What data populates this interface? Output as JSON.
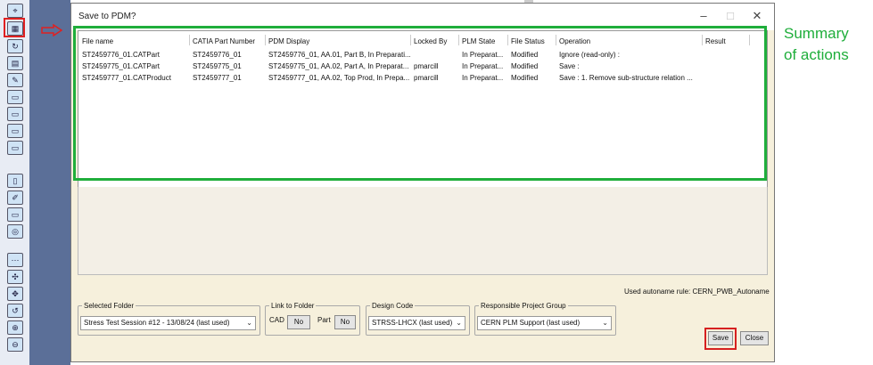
{
  "dialog": {
    "title": "Save to PDM?",
    "columns": [
      "File name",
      "CATIA Part Number",
      "PDM Display",
      "Locked By",
      "PLM State",
      "File Status",
      "Operation",
      "Result"
    ],
    "rows": [
      {
        "file": "ST2459776_01.CATPart",
        "part": "ST2459776_01",
        "display": "ST2459776_01, AA.01, Part B, In Preparati...",
        "locked": "",
        "state": "In Preparat...",
        "status": "Modified",
        "operation": "Ignore (read-only) :",
        "result": ""
      },
      {
        "file": "ST2459775_01.CATPart",
        "part": "ST2459775_01",
        "display": "ST2459775_01, AA.02, Part A, In Preparat...",
        "locked": "pmarcill",
        "state": "In Preparat...",
        "status": "Modified",
        "operation": "Save :",
        "result": ""
      },
      {
        "file": "ST2459777_01.CATProduct",
        "part": "ST2459777_01",
        "display": "ST2459777_01, AA.02, Top Prod, In Prepa...",
        "locked": "pmarcill",
        "state": "In Preparat...",
        "status": "Modified",
        "operation": "Save : 1. Remove sub-structure relation ...",
        "result": ""
      }
    ],
    "autoname": "Used autoname rule: CERN_PWB_Autoname",
    "selected_folder": {
      "label": "Selected Folder",
      "value": "Stress Test Session #12 - 13/08/24 (last used)"
    },
    "link_to_folder": {
      "label": "Link to Folder",
      "cad": "CAD",
      "cad_value": "No",
      "part": "Part",
      "part_value": "No"
    },
    "design_code": {
      "label": "Design Code",
      "value": "STRSS-LHCX (last used)"
    },
    "project_group": {
      "label": "Responsible Project Group",
      "value": "CERN PLM Support (last used)"
    },
    "save_label": "Save",
    "close_label": "Close"
  },
  "annotation": {
    "summary_line1": "Summary",
    "summary_line2": "of actions",
    "color": "#1fae3b"
  },
  "icons": {
    "arrow": "right-arrow-icon",
    "toolbar": "catia-toolbar-icons"
  }
}
